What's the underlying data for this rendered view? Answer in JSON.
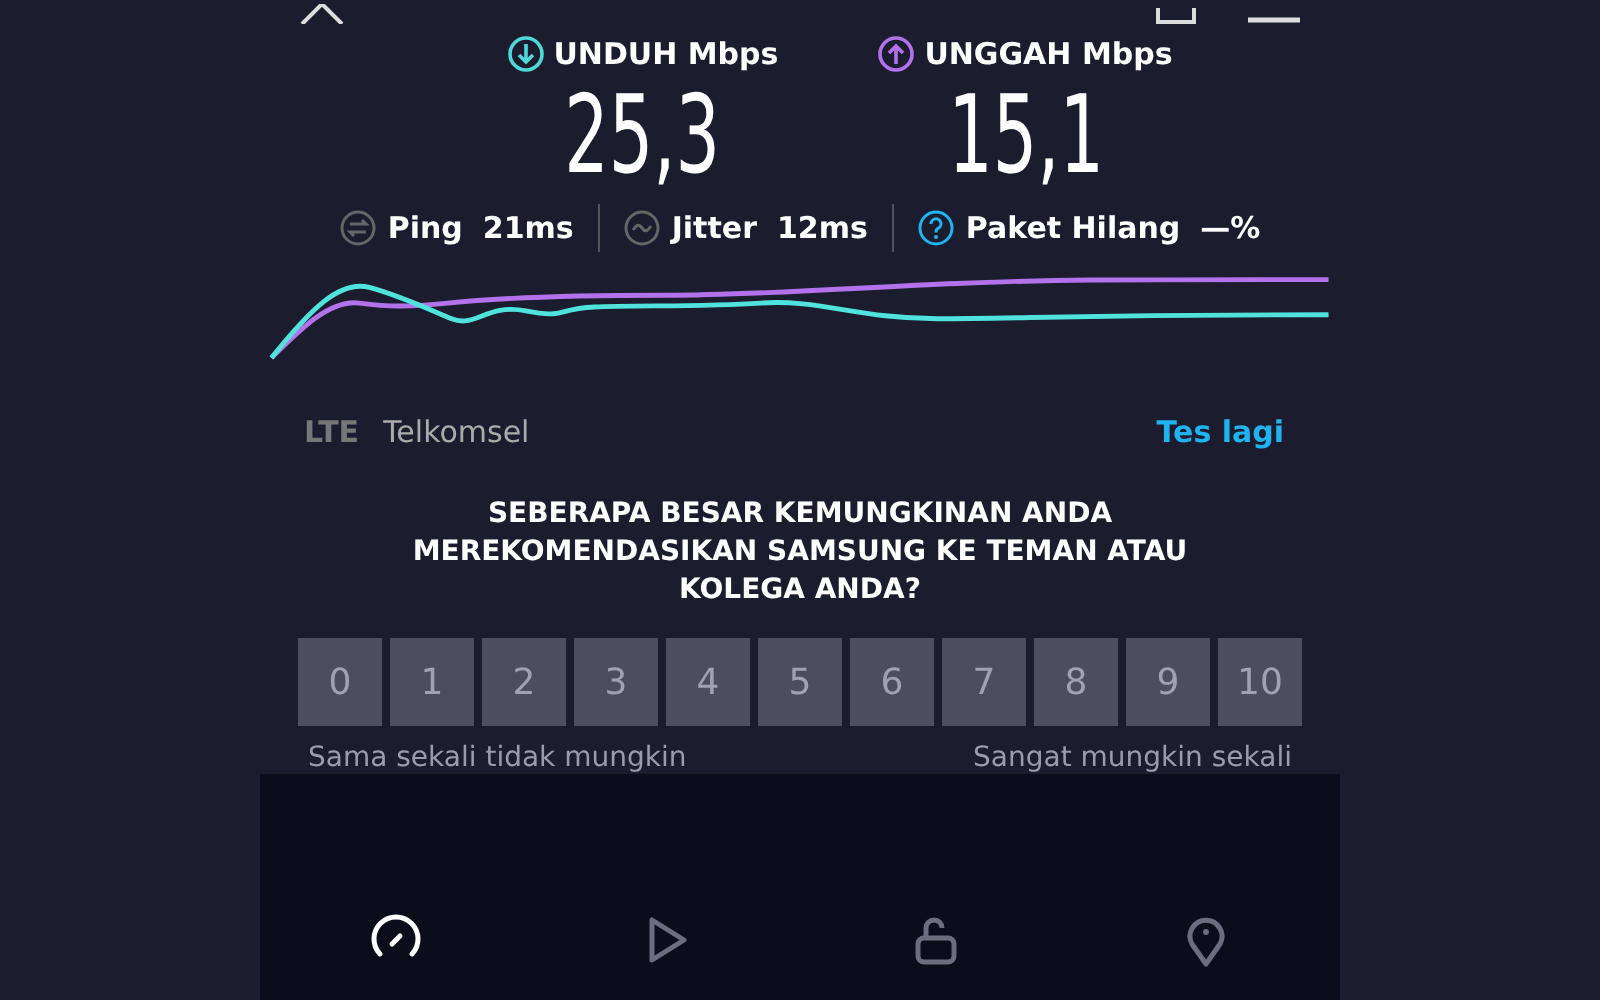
{
  "results": [
    {
      "kind": "download",
      "label": "UNDUH Mbps",
      "value": "25,3"
    },
    {
      "kind": "upload",
      "label": "UNGGAH Mbps",
      "value": "15,1"
    }
  ],
  "metrics": [
    {
      "kind": "ping",
      "label": "Ping",
      "value": "21ms"
    },
    {
      "kind": "jitter",
      "label": "Jitter",
      "value": "12ms"
    },
    {
      "kind": "loss",
      "label": "Paket Hilang",
      "value": "—%"
    }
  ],
  "connection": {
    "type": "LTE",
    "provider": "Telkomsel",
    "action": "Tes lagi"
  },
  "survey": {
    "question": "SEBERAPA BESAR KEMUNGKINAN ANDA MEREKOMENDASIKAN SAMSUNG KE TEMAN ATAU KOLEGA ANDA?",
    "scale": [
      "0",
      "1",
      "2",
      "3",
      "4",
      "5",
      "6",
      "7",
      "8",
      "9",
      "10"
    ],
    "low_label": "Sama sekali tidak mungkin",
    "high_label": "Sangat mungkin sekali"
  },
  "nav": [
    {
      "kind": "speed",
      "selected": true
    },
    {
      "kind": "video",
      "selected": false
    },
    {
      "kind": "vpn",
      "selected": false
    },
    {
      "kind": "map",
      "selected": false
    }
  ]
}
